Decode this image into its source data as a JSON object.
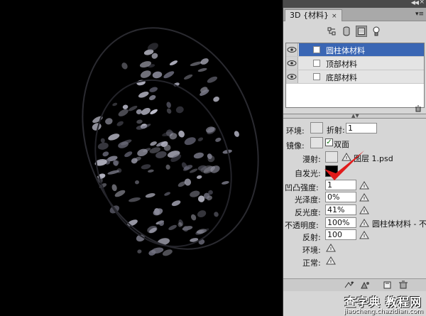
{
  "panel": {
    "tab_label": "3D {材料}",
    "materials": [
      {
        "label": "圆柱体材料",
        "selected": true
      },
      {
        "label": "顶部材料",
        "selected": false
      },
      {
        "label": "底部材料",
        "selected": false
      }
    ],
    "properties": {
      "ambient_label": "环境:",
      "refraction_label": "折射:",
      "refraction_value": "1",
      "specular_label": "镜像:",
      "double_sided_label": "双面",
      "diffuse_label": "漫射:",
      "diffuse_texture": "图层 1.psd",
      "emissive_label": "自发光:",
      "bump_label": "凹凸强度:",
      "bump_value": "1",
      "glossiness_label": "光泽度:",
      "glossiness_value": "0%",
      "shine_label": "反光度:",
      "shine_value": "41%",
      "opacity_label": "不透明度:",
      "opacity_value": "100%",
      "opacity_texture": "圆柱体材料 - 不",
      "reflection_label": "反射:",
      "reflection_value": "100",
      "environment_label": "环境:",
      "normal_label": "正常:"
    }
  },
  "watermark": {
    "line1": "查字典 教程网",
    "line2": "jiaocheng.chazidian.com"
  },
  "colors": {
    "selection": "#3a66b4",
    "annotation": "#e11b1b",
    "panel_bg": "#d6d6d6",
    "canvas_bg": "#000000"
  }
}
